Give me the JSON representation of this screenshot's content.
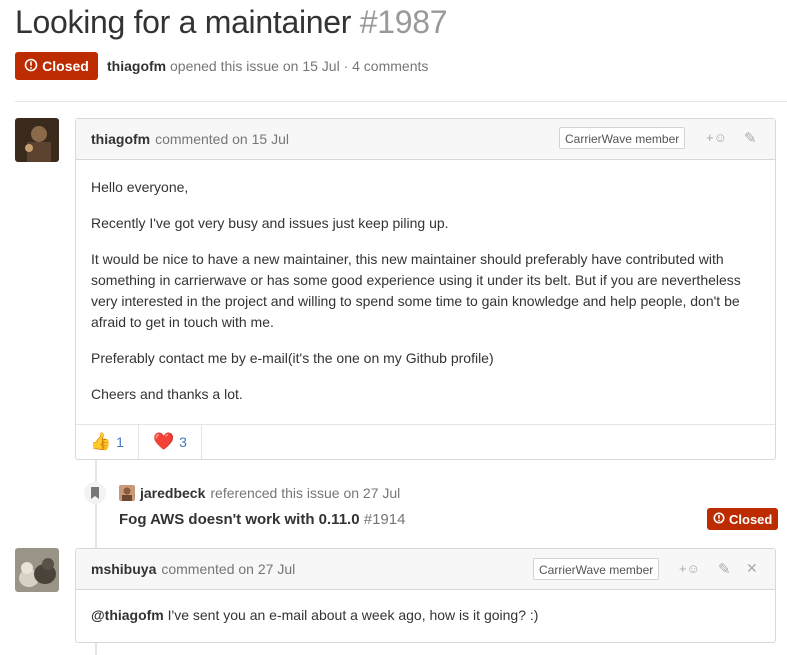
{
  "issue": {
    "title": "Looking for a maintainer",
    "number": "#1987",
    "state": "Closed",
    "author": "thiagofm",
    "meta_text": "opened this issue on 15 Jul · 4 comments"
  },
  "comments": [
    {
      "author": "thiagofm",
      "action": "commented on 15 Jul",
      "badge": "CarrierWave member",
      "paragraphs": [
        "Hello everyone,",
        "Recently I've got very busy and issues just keep piling up.",
        "It would be nice to have a new maintainer, this new maintainer should preferably have contributed with something in carrierwave or has some good experience using it under its belt. But if you are nevertheless very interested in the project and willing to spend some time to gain knowledge and help people, don't be afraid to get in touch with me.",
        "Preferably contact me by e-mail(it's the one on my Github profile)",
        "Cheers and thanks a lot."
      ],
      "reactions": [
        {
          "emoji": "👍",
          "count": "1"
        },
        {
          "emoji": "❤️",
          "count": "3"
        }
      ]
    },
    {
      "author": "mshibuya",
      "action": "commented on 27 Jul",
      "badge": "CarrierWave member",
      "mention": "@thiagofm",
      "body": " I've sent you an e-mail about a week ago, how is it going? :)"
    }
  ],
  "reference": {
    "user": "jaredbeck",
    "text": "referenced this issue on 27 Jul",
    "title": "Fog AWS doesn't work with 0.11.0",
    "number": "#1914",
    "state": "Closed"
  },
  "icons": {
    "add_reaction": "+☺",
    "edit": "✎",
    "close": "✕",
    "bookmark": "bookmark-icon"
  },
  "colors": {
    "closed": "#bd2c00",
    "link": "#4078c0"
  }
}
